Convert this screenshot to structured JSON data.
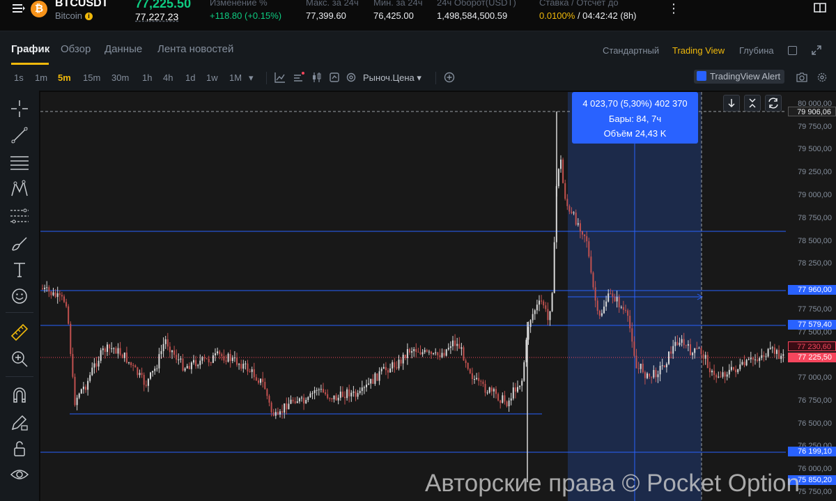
{
  "ticker": {
    "symbol": "BTCUSDT",
    "name": "Bitcoin",
    "coin_glyph": "₿",
    "last_price": "77,225.50",
    "mark_price": "77,227.23",
    "stats": [
      {
        "label": "Изменение %",
        "value": "+118.80 (+0.15%)",
        "color": "green"
      },
      {
        "label": "Макс. за 24ч",
        "value": "77,399.60"
      },
      {
        "label": "Мин. за 24ч",
        "value": "76,425.00"
      },
      {
        "label": "24ч Оборот(USDT)",
        "value": "1,498,584,500.59"
      },
      {
        "label": "Ставка / Отсчет до",
        "value_rate": "0.0100%",
        "value_rest": " / 04:42:42 (8h)"
      }
    ],
    "more": "⋮"
  },
  "tabs": [
    {
      "label": "График",
      "active": true
    },
    {
      "label": "Обзор"
    },
    {
      "label": "Данные"
    },
    {
      "label": "Лента новостей"
    }
  ],
  "views": [
    {
      "label": "Стандартный"
    },
    {
      "label": "Trading View",
      "active": true
    },
    {
      "label": "Глубина"
    }
  ],
  "timeframes": [
    "1s",
    "1m",
    "5m",
    "15m",
    "30m",
    "1h",
    "4h",
    "1d",
    "1w",
    "1M"
  ],
  "active_timeframe": "5m",
  "toolbar": {
    "more_tf": "▾",
    "price_type": "Рыноч.Цена",
    "price_type_caret": "▾",
    "alert": "TradingView Alert"
  },
  "measurement": {
    "line1": "4 023,70 (5,30%) 402 370",
    "line2": "Бары: 84, 7ч",
    "line3": "Объём 24,43 K"
  },
  "price_axis": {
    "ticks": [
      "80 000,00",
      "79 750,00",
      "79 500,00",
      "79 250,00",
      "79 000,00",
      "78 750,00",
      "78 500,00",
      "78 250,00",
      "77 750,00",
      "77 500,00",
      "77 000,00",
      "76 750,00",
      "76 500,00",
      "76 250,00",
      "76 000,00",
      "75 750,00"
    ],
    "labels": {
      "high": "79 906,06",
      "line_top": "77 960,00",
      "line_mid": "77 579,40",
      "current_dark": "77 230,60",
      "current": "77 225,50",
      "line_low": "76 199,10",
      "bottom": "75 850,20"
    }
  },
  "colors": {
    "up": "#d9d9d9",
    "down": "#c2514f",
    "hline": "#2962ff",
    "accent": "#f0b90b",
    "green": "#0ecb81"
  },
  "watermark": "Авторские права © Pocket Option"
}
